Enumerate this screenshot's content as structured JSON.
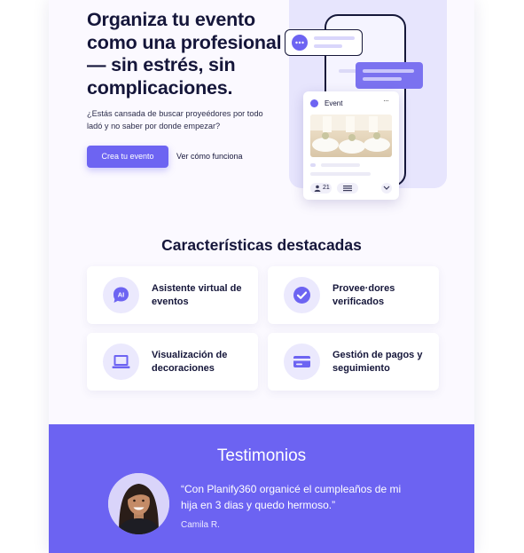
{
  "hero": {
    "title": "Organiza tu evento como una profesional — sin estrés, sin complicaciones.",
    "subtitle": "¿Estás cansada de buscar proyeédores por todo ladó y no saber por donde empezar?",
    "primary_cta": "Crea tu evento",
    "secondary_cta": "Ver cómo funciona"
  },
  "illustration": {
    "chat_icon": "chat-bubble-icon",
    "event_card": {
      "label": "Event",
      "more": "···",
      "guest_count": "21"
    }
  },
  "features": {
    "title": "Características destacadas",
    "items": [
      {
        "label": "Asistente virtual de eventos",
        "icon": "ai-chat-icon",
        "icon_text": "AI"
      },
      {
        "label": "Provee·dores verificados",
        "icon": "verified-check-icon"
      },
      {
        "label": "Visualización de decoraciones",
        "icon": "laptop-icon"
      },
      {
        "label": "Gestión de pagos y seguimiento",
        "icon": "credit-card-icon"
      }
    ]
  },
  "testimonials": {
    "title": "Testimonios",
    "quote": "“Con Planify360 organicé el cumpleaños de mi hija en 3 dias y quedo hermoso.”",
    "author": "Camila R."
  },
  "colors": {
    "accent": "#6d64f2",
    "accent_light": "#ebe9fd",
    "text_dark": "#15163a",
    "testimonial_bg": "#6c63f2"
  }
}
